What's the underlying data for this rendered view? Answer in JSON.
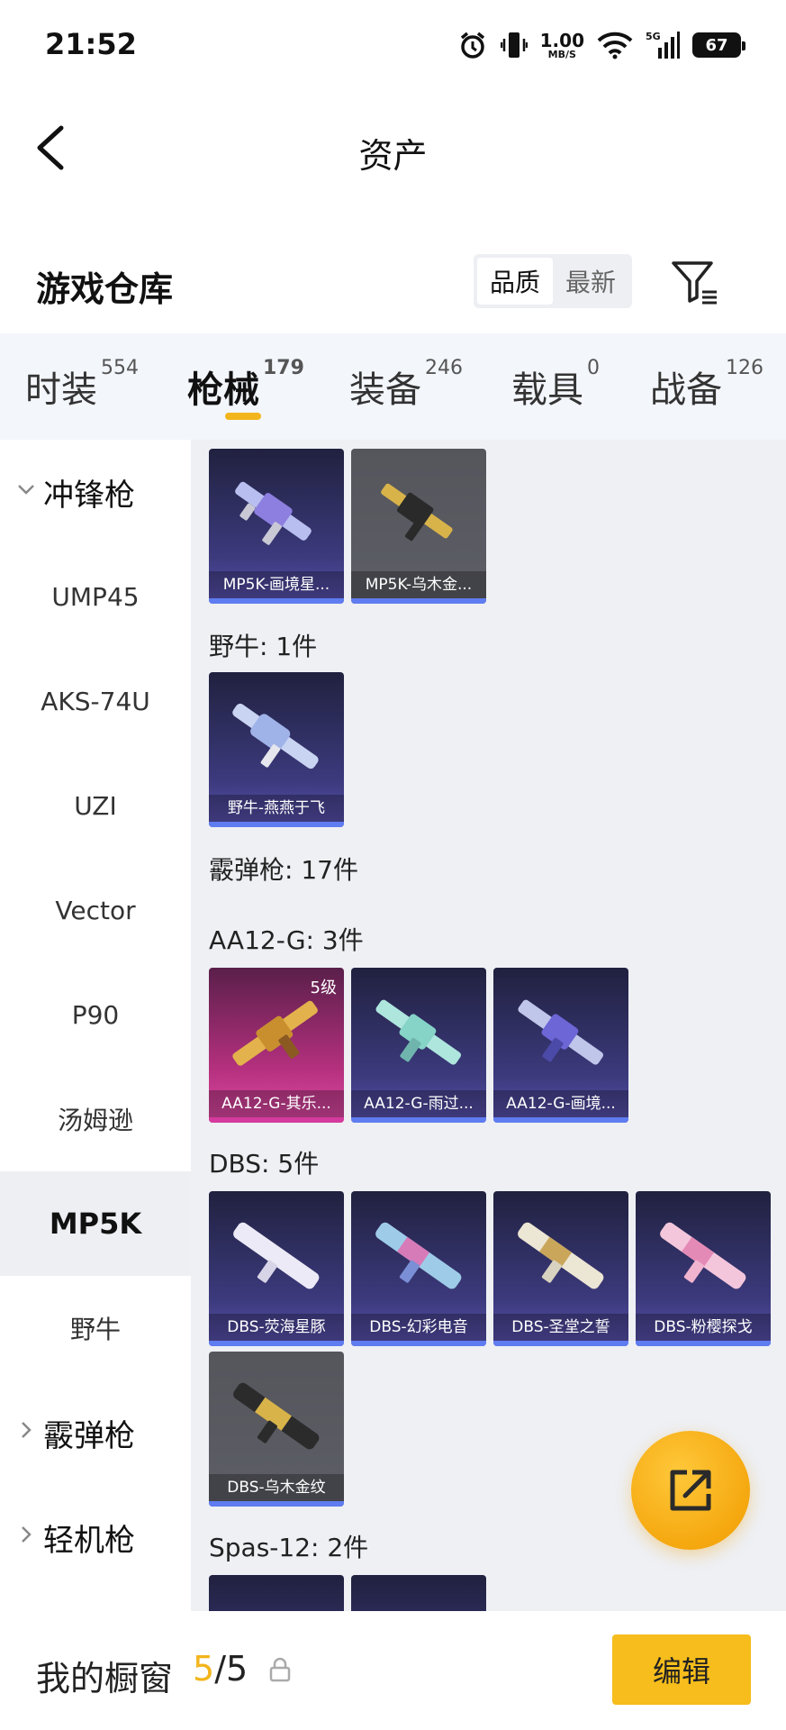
{
  "status_bar": {
    "time": "21:52",
    "net_speed": "1.00",
    "net_unit": "MB/S",
    "network": "5G",
    "battery": "67"
  },
  "header": {
    "title": "资产"
  },
  "section": {
    "title": "游戏仓库",
    "sort_quality": "品质",
    "sort_latest": "最新"
  },
  "tabs": [
    {
      "label": "时装",
      "count": "554"
    },
    {
      "label": "枪械",
      "count": "179"
    },
    {
      "label": "装备",
      "count": "246"
    },
    {
      "label": "载具",
      "count": "0"
    },
    {
      "label": "战备",
      "count": "126"
    }
  ],
  "sidebar": {
    "groups": {
      "smg": "冲锋枪",
      "shotgun": "霰弹枪",
      "lmg": "轻机枪"
    },
    "items": [
      "UMP45",
      "AKS-74U",
      "UZI",
      "Vector",
      "P90",
      "汤姆逊",
      "MP5K",
      "野牛"
    ]
  },
  "content": {
    "mp5k_items": [
      "MP5K-画境星...",
      "MP5K-乌木金..."
    ],
    "bison_label": "野牛: 1件",
    "bison_items": [
      "野牛-燕燕于飞"
    ],
    "shotgun_label": "霰弹枪: 17件",
    "aa12_label": "AA12-G: 3件",
    "aa12_items": [
      "AA12-G-其乐...",
      "AA12-G-雨过...",
      "AA12-G-画境..."
    ],
    "aa12_level": "5级",
    "dbs_label": "DBS: 5件",
    "dbs_items": [
      "DBS-荧海星豚",
      "DBS-幻彩电音",
      "DBS-圣堂之誓",
      "DBS-粉樱探戈",
      "DBS-乌木金纹"
    ],
    "spas_label": "Spas-12: 2件"
  },
  "bottom": {
    "label": "我的橱窗",
    "current": "5",
    "separator": "/",
    "total": "5",
    "edit": "编辑"
  },
  "colors": {
    "accent": "#f2b51b",
    "tile_purple": "#3c3a7d",
    "tile_gray": "#5d5e66",
    "tile_pink": "#b4307e",
    "quality_bar": "#5f7cf0"
  }
}
